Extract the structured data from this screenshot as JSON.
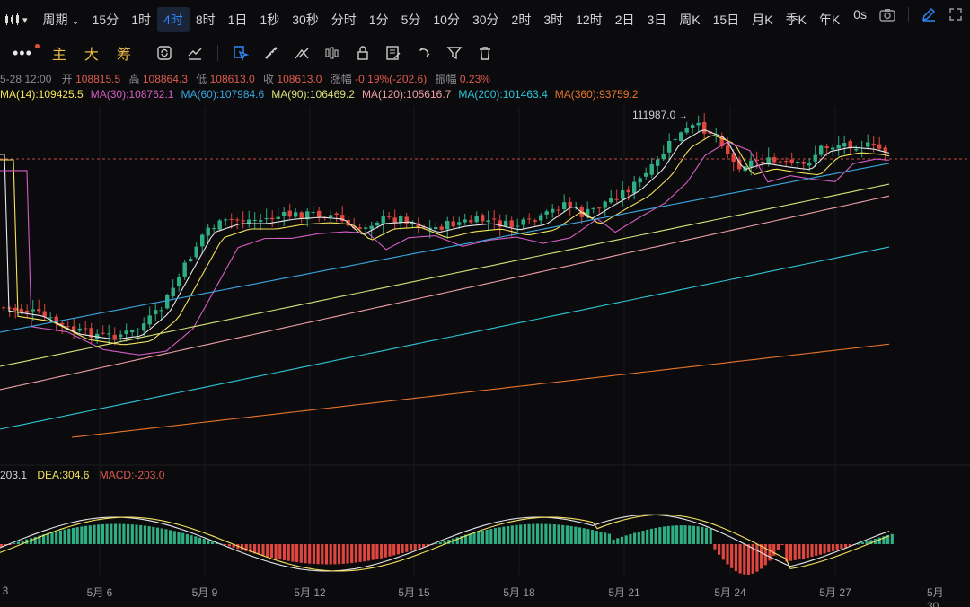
{
  "topbar": {
    "chart_type_label": "周期",
    "timeframes": [
      "15分",
      "1时",
      "4时",
      "8时",
      "1日",
      "1秒",
      "30秒",
      "分时",
      "1分",
      "5分",
      "10分",
      "30分",
      "2时",
      "3时",
      "12时",
      "2日",
      "3日",
      "周K",
      "15日",
      "月K",
      "季K",
      "年K"
    ],
    "active_timeframe": "4时",
    "countdown": "0s"
  },
  "drawbar": {
    "more": "•••",
    "modes": [
      "主",
      "大",
      "筹"
    ]
  },
  "ohlc": {
    "time": "5-28 12:00",
    "open_label": "开",
    "open": "108815.5",
    "high_label": "高",
    "high": "108864.3",
    "low_label": "低",
    "low": "108613.0",
    "close_label": "收",
    "close": "108613.0",
    "change_label": "涨幅",
    "change": "-0.19%(-202.6)",
    "amp_label": "振幅",
    "amp": "0.23%"
  },
  "ma_legend": [
    {
      "text": "MA(14):109425.5",
      "color": "#f3e35c"
    },
    {
      "text": "MA(30):108762.1",
      "color": "#d45cc4"
    },
    {
      "text": "MA(60):107984.6",
      "color": "#3aa6e0"
    },
    {
      "text": "MA(90):106469.2",
      "color": "#d8e07a"
    },
    {
      "text": "MA(120):105616.7",
      "color": "#f0a0a8"
    },
    {
      "text": "MA(200):101463.4",
      "color": "#2ec4d6"
    },
    {
      "text": "MA(360):93759.2",
      "color": "#e8742a"
    }
  ],
  "peak_label": "111987.0",
  "macd_legend": {
    "dif": "203.1",
    "dea": "DEA:304.6",
    "macd": "MACD:-203.0"
  },
  "x_axis": [
    "3",
    "5月 6",
    "5月 9",
    "5月 12",
    "5月 15",
    "5月 18",
    "5月 21",
    "5月 24",
    "5月 27",
    "5月 30"
  ],
  "colors": {
    "up": "#2fae84",
    "down": "#e0453e",
    "accent": "#2f86f6",
    "background": "#0b0b0d"
  }
}
